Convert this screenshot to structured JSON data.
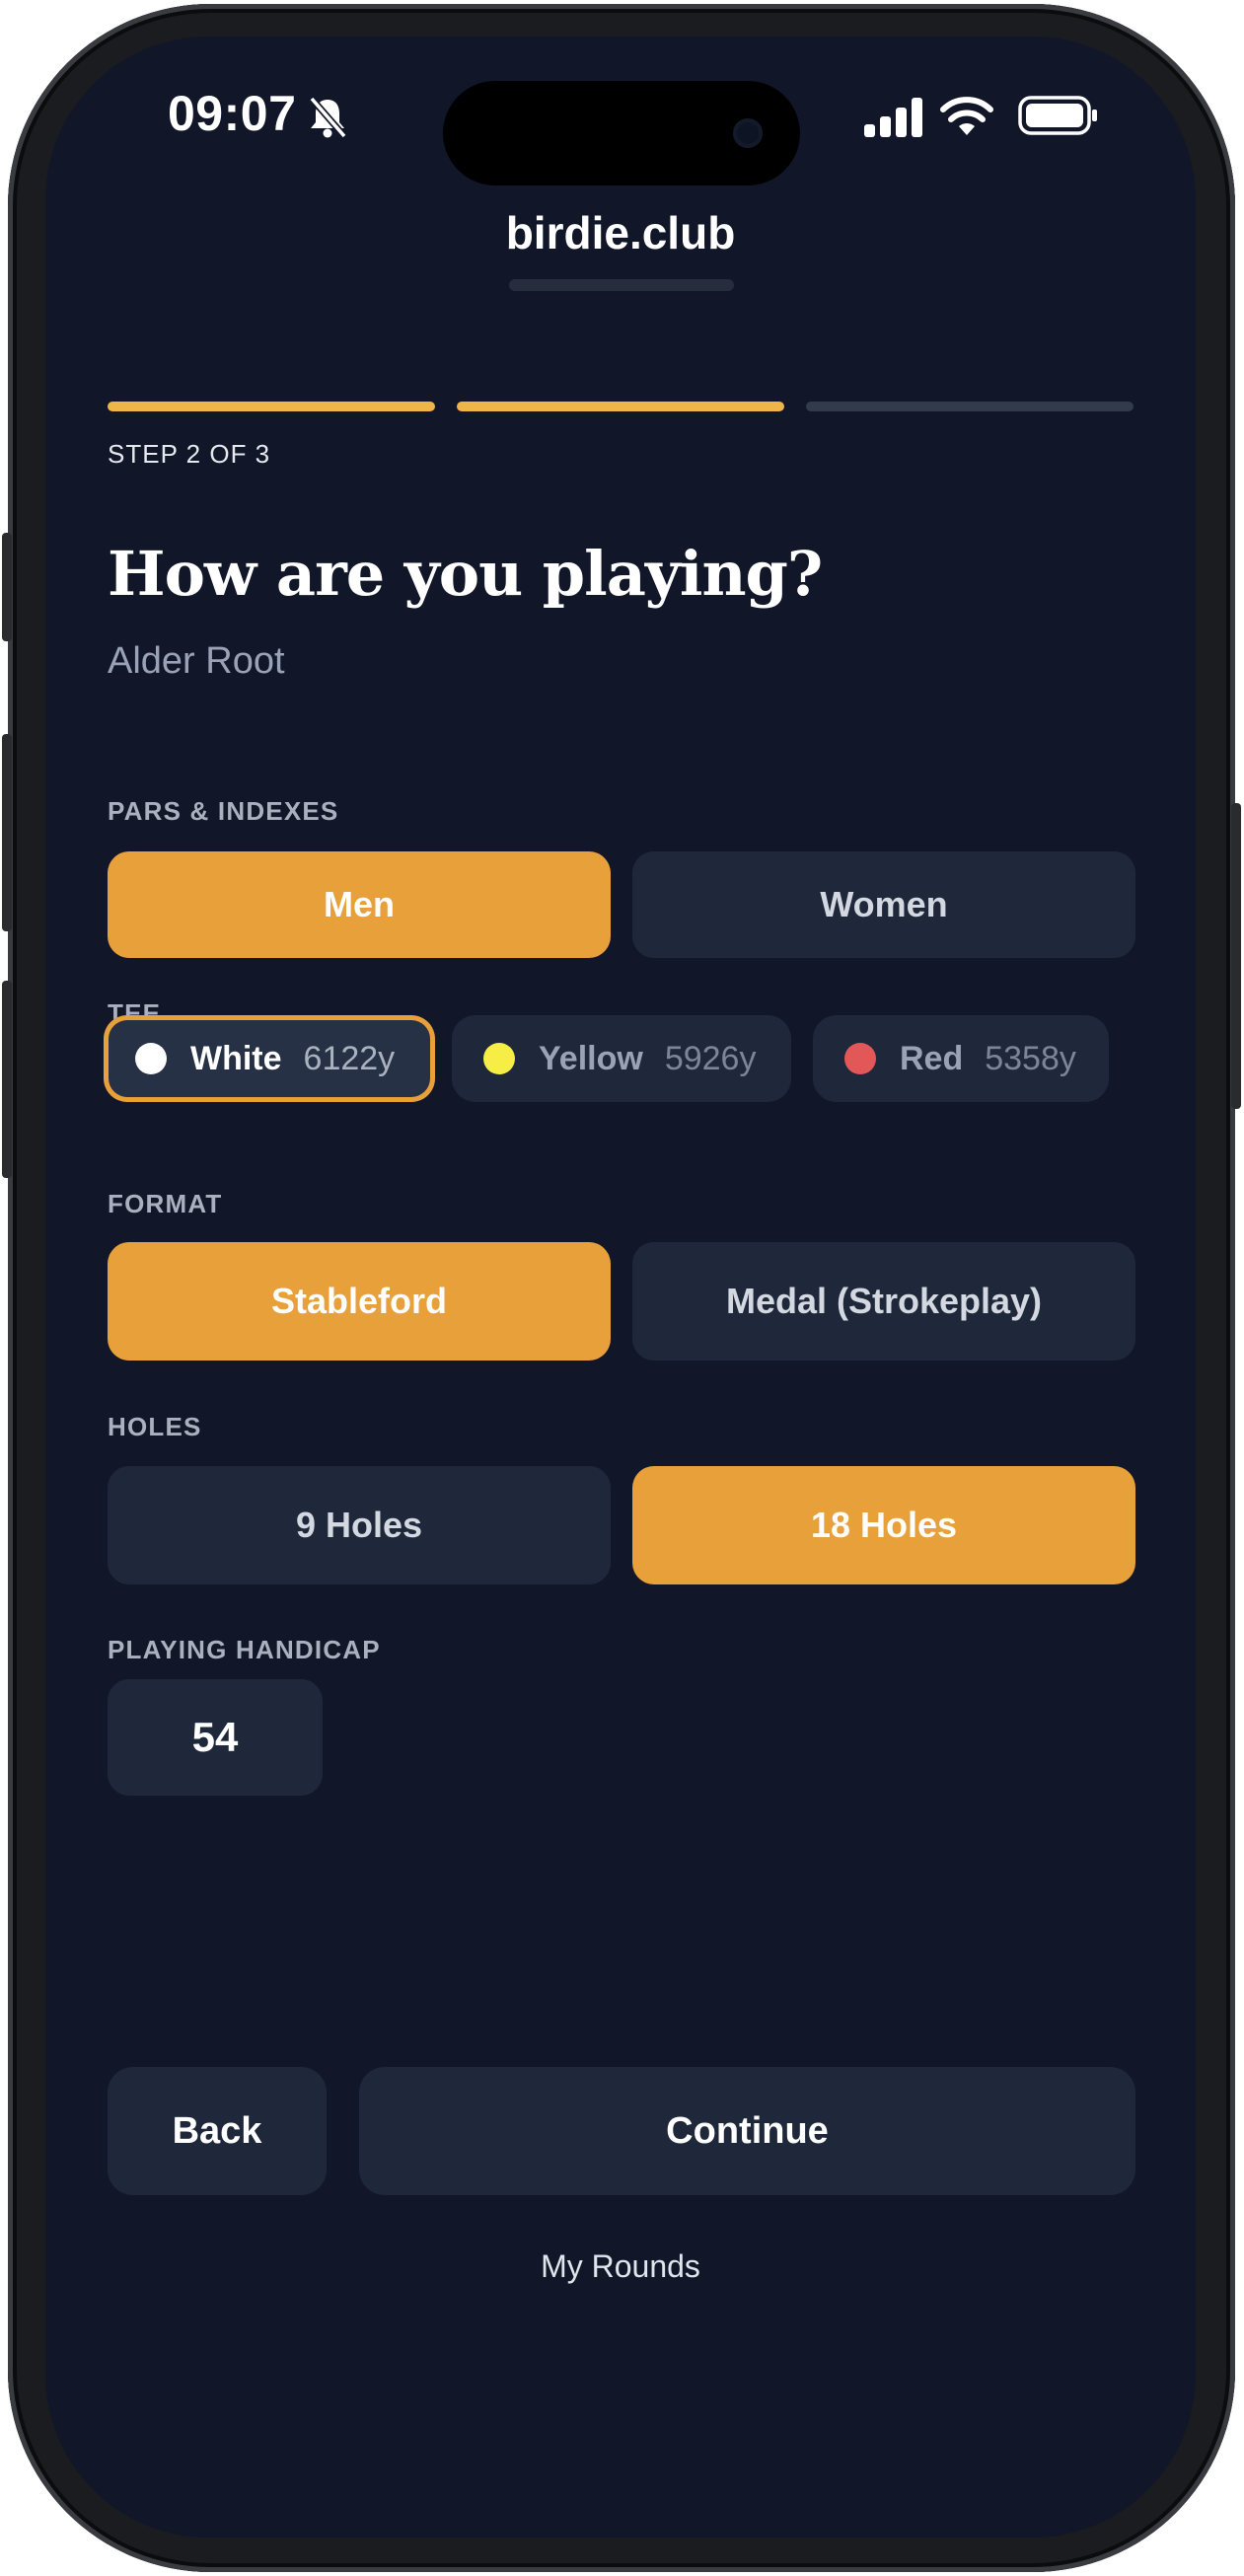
{
  "status_bar": {
    "time": "09:07"
  },
  "brand": "birdie.club",
  "progress": {
    "step_label": "STEP 2 OF 3",
    "steps_total": 3,
    "steps_completed": 2
  },
  "title": "How are you playing?",
  "course": "Alder Root",
  "pars_indexes": {
    "label": "PARS & INDEXES",
    "options": [
      "Men",
      "Women"
    ],
    "selected": "Men"
  },
  "tee": {
    "label": "TEE",
    "options": [
      {
        "name": "White",
        "yards": "6122y",
        "color": "#ffffff"
      },
      {
        "name": "Yellow",
        "yards": "5926y",
        "color": "#f6ee45"
      },
      {
        "name": "Red",
        "yards": "5358y",
        "color": "#e25858"
      }
    ],
    "selected": "White"
  },
  "format": {
    "label": "FORMAT",
    "options": [
      "Stableford",
      "Medal (Strokeplay)"
    ],
    "selected": "Stableford"
  },
  "holes": {
    "label": "HOLES",
    "options": [
      "9 Holes",
      "18 Holes"
    ],
    "selected": "18 Holes"
  },
  "handicap": {
    "label": "PLAYING HANDICAP",
    "value": "54"
  },
  "footer": {
    "back": "Back",
    "continue": "Continue",
    "my_rounds": "My Rounds"
  },
  "colors": {
    "accent": "#e8a03b",
    "progress_active": "#f0b548",
    "progress_inactive": "#323b4b",
    "background": "#111729",
    "button_inactive": "#1f283a"
  },
  "icons": [
    "bell-slash-icon",
    "cellular-signal-icon",
    "wifi-icon",
    "battery-icon"
  ]
}
